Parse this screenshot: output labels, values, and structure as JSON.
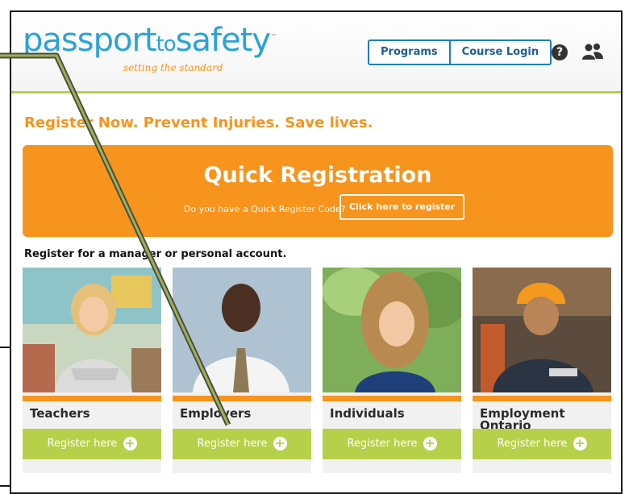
{
  "header": {
    "logo_passport": "passport",
    "logo_to": "to",
    "logo_safety": "safety",
    "logo_tm": "™",
    "logo_tagline": "setting the standard",
    "nav": [
      "Programs",
      "Course Login"
    ],
    "help_icon": "question-circle-icon",
    "users_icon": "users-icon"
  },
  "main": {
    "headline": "Register Now. Prevent Injuries. Save lives.",
    "quick_title": "Quick Registration",
    "quick_question": "Do you have a Quick Register Code?",
    "quick_button": "Click here to register",
    "subheading": "Register for a manager or personal account.",
    "cards": [
      {
        "title": "Teachers",
        "button": "Register here"
      },
      {
        "title": "Employers",
        "button": "Register here"
      },
      {
        "title": "Individuals",
        "button": "Register here"
      },
      {
        "title": "Employment Ontario",
        "button": "Register here"
      }
    ]
  },
  "colors": {
    "orange": "#f7941d",
    "green": "#b7d04a",
    "blue": "#1d7fb8"
  }
}
